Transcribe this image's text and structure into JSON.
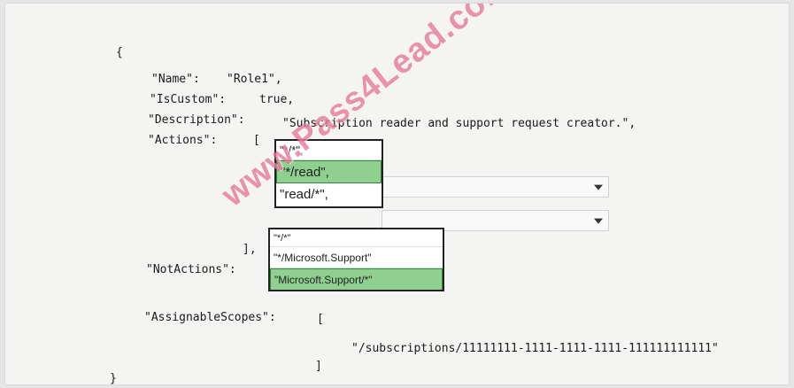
{
  "json_text": {
    "open_brace": "{",
    "name_key": "\"Name\":",
    "name_val": "\"Role1\",",
    "iscustom_key": "\"IsCustom\":",
    "iscustom_val": "true,",
    "desc_key": "\"Description\":",
    "desc_val": "\"Subscription reader and support request creator.\",",
    "actions_key": "\"Actions\":",
    "actions_open": "[",
    "actions_close": "],",
    "notactions_key": "\"NotActions\":",
    "assignable_key": "\"AssignableScopes\":",
    "assignable_open": "[",
    "scope_value": "\"/subscriptions/11111111-1111-1111-1111-111111111111\"",
    "assignable_close": "]",
    "close_brace": "}"
  },
  "actions_dropdown": {
    "options": [
      "\"*/*\",",
      "\"*/read\",",
      "\"read/*\","
    ],
    "selected": "\"*/read\","
  },
  "notactions_dropdown": {
    "options": [
      "\"*/*\"",
      "\"*/Microsoft.Support\"",
      "\"Microsoft.Support/*\""
    ],
    "selected": "\"Microsoft.Support/*\""
  },
  "watermark": "www.Pass4Lead.com",
  "colors": {
    "selected_bg": "#8fcf8f",
    "watermark": "#dc3c6e"
  }
}
